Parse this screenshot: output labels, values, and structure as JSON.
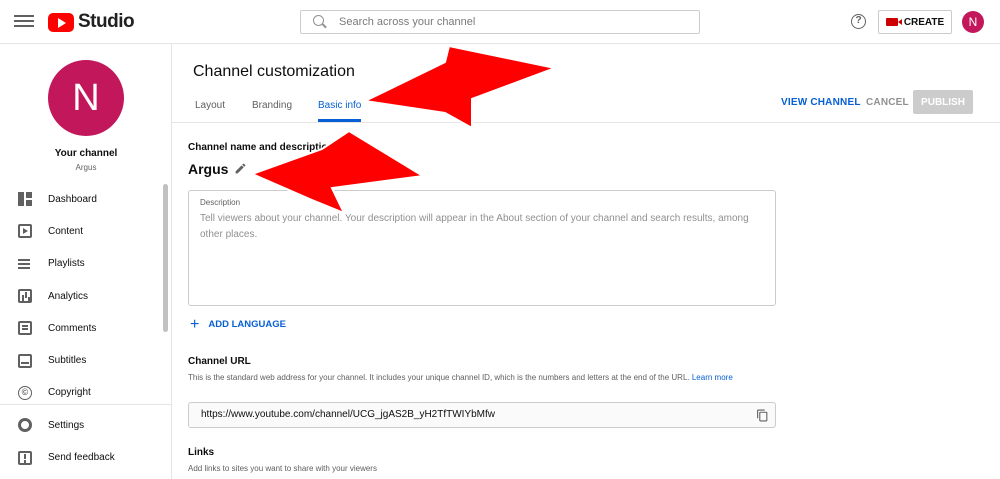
{
  "topbar": {
    "logo_text": "Studio",
    "search_placeholder": "Search across your channel",
    "help_glyph": "?",
    "create_label": "CREATE",
    "avatar_letter": "N"
  },
  "sidebar": {
    "avatar_letter": "N",
    "channel_label": "Your channel",
    "channel_name": "Argus",
    "items": [
      {
        "label": "Dashboard",
        "icon": "dashboard-icon"
      },
      {
        "label": "Content",
        "icon": "content-icon"
      },
      {
        "label": "Playlists",
        "icon": "playlists-icon"
      },
      {
        "label": "Analytics",
        "icon": "analytics-icon"
      },
      {
        "label": "Comments",
        "icon": "comments-icon"
      },
      {
        "label": "Subtitles",
        "icon": "subtitles-icon"
      },
      {
        "label": "Copyright",
        "icon": "copyright-icon"
      },
      {
        "label": "Settings",
        "icon": "settings-icon"
      },
      {
        "label": "Send feedback",
        "icon": "feedback-icon"
      }
    ],
    "copyright_glyph": "©"
  },
  "main": {
    "title": "Channel customization",
    "tabs": [
      {
        "label": "Layout"
      },
      {
        "label": "Branding"
      },
      {
        "label": "Basic info",
        "active": true
      }
    ],
    "view_channel_label": "VIEW CHANNEL",
    "cancel_label": "CANCEL",
    "publish_label": "PUBLISH",
    "name_section_label": "Channel name and description",
    "channel_name": "Argus",
    "description_label": "Description",
    "description_placeholder": "Tell viewers about your channel. Your description will appear in the About section of your channel and search results, among other places.",
    "add_language_label": "ADD LANGUAGE",
    "plus_glyph": "+",
    "url_section_label": "Channel URL",
    "url_help": "This is the standard web address for your channel. It includes your unique channel ID, which is the numbers and letters at the end of the URL.",
    "url_help_link": "Learn more",
    "channel_url": "https://www.youtube.com/channel/UCG_jgAS2B_yH2TfTWIYbMfw",
    "links_section_label": "Links",
    "links_help": "Add links to sites you want to share with your viewers"
  },
  "colors": {
    "accent": "#065fd4",
    "brand_red": "#ff0000",
    "avatar": "#c2185b",
    "annotation_arrow": "#ff0000"
  }
}
